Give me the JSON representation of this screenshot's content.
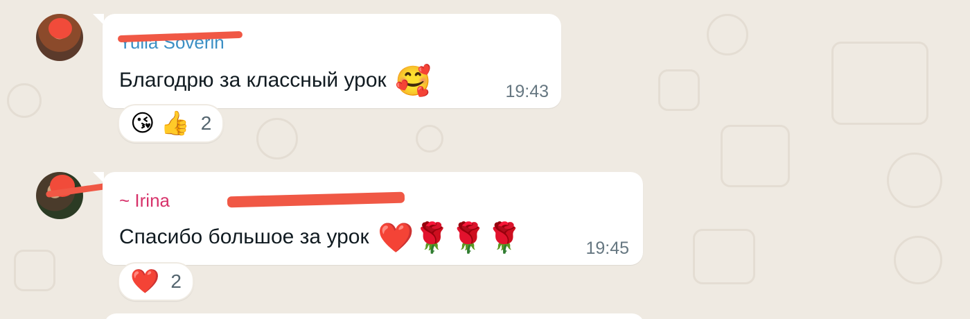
{
  "messages": [
    {
      "sender": "Yulia Soverin",
      "text": "Благодрю за классный урок",
      "emoji": "🥰",
      "time": "19:43",
      "reactions": {
        "emojis": [
          "😘",
          "👍"
        ],
        "count": "2"
      }
    },
    {
      "sender": "~ Irina",
      "text": "Спасибо большое за урок",
      "emoji": "❤️🌹🌹🌹",
      "time": "19:45",
      "reactions": {
        "emojis": [
          "❤️"
        ],
        "count": "2"
      }
    }
  ],
  "colors": {
    "background": "#efeae2",
    "bubble": "#ffffff",
    "sender_1": "#3b8fc4",
    "sender_2": "#d7336b",
    "redaction": "#f05845",
    "timestamp": "#667781"
  }
}
